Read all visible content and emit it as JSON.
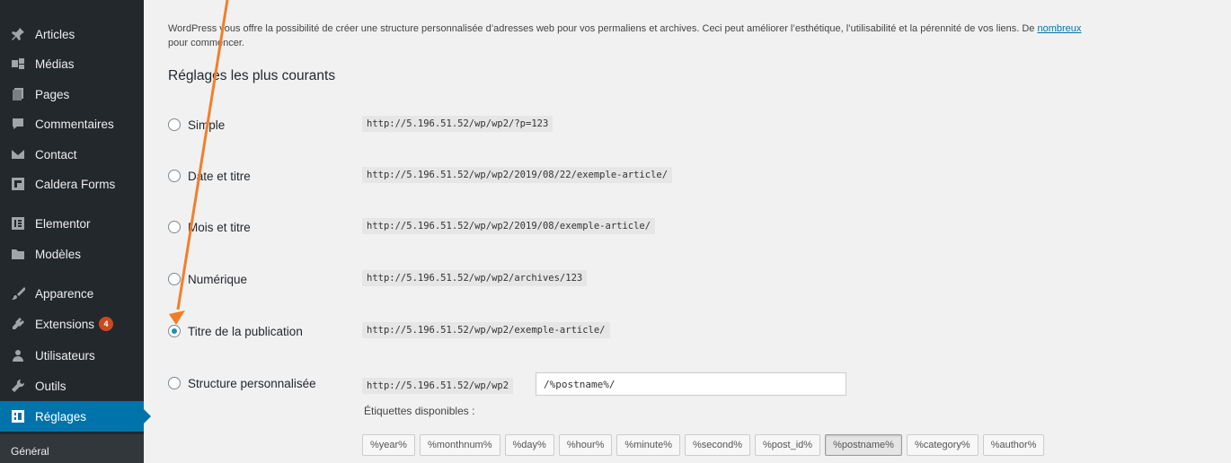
{
  "sidebar": {
    "items": [
      {
        "label": "Articles",
        "icon": "pin-icon"
      },
      {
        "label": "Médias",
        "icon": "media-icon"
      },
      {
        "label": "Pages",
        "icon": "pages-icon"
      },
      {
        "label": "Commentaires",
        "icon": "comment-icon"
      },
      {
        "label": "Contact",
        "icon": "mail-icon"
      },
      {
        "label": "Caldera Forms",
        "icon": "caldera-icon"
      },
      {
        "label": "Elementor",
        "icon": "elementor-icon"
      },
      {
        "label": "Modèles",
        "icon": "folder-icon"
      },
      {
        "label": "Apparence",
        "icon": "brush-icon"
      },
      {
        "label": "Extensions",
        "icon": "plugin-icon",
        "badge": "4"
      },
      {
        "label": "Utilisateurs",
        "icon": "users-icon"
      },
      {
        "label": "Outils",
        "icon": "wrench-icon"
      },
      {
        "label": "Réglages",
        "icon": "settings-icon",
        "active": true
      }
    ],
    "submenu": {
      "label": "Général"
    }
  },
  "intro": {
    "text": "WordPress vous offre la possibilité de créer une structure personnalisée d’adresses web pour vos permaliens et archives. Ceci peut améliorer l’esthétique, l’utilisabilité et la pérennité de vos liens. De ",
    "link": "nombreux",
    "line2": "pour commencer."
  },
  "section_title": "Réglages les plus courants",
  "options": [
    {
      "label": "Simple",
      "url": "http://5.196.51.52/wp/wp2/?p=123",
      "checked": false
    },
    {
      "label": "Date et titre",
      "url": "http://5.196.51.52/wp/wp2/2019/08/22/exemple-article/",
      "checked": false
    },
    {
      "label": "Mois et titre",
      "url": "http://5.196.51.52/wp/wp2/2019/08/exemple-article/",
      "checked": false
    },
    {
      "label": "Numérique",
      "url": "http://5.196.51.52/wp/wp2/archives/123",
      "checked": false
    },
    {
      "label": "Titre de la publication",
      "url": "http://5.196.51.52/wp/wp2/exemple-article/",
      "checked": true
    },
    {
      "label": "Structure personnalisée",
      "url": "http://5.196.51.52/wp/wp2",
      "checked": false
    }
  ],
  "custom_structure_value": "/%postname%/",
  "available_tags_label": "Étiquettes disponibles :",
  "tags": [
    "%year%",
    "%monthnum%",
    "%day%",
    "%hour%",
    "%minute%",
    "%second%",
    "%post_id%",
    "%postname%",
    "%category%",
    "%author%"
  ],
  "active_tag": "%postname%",
  "colors": {
    "sidebar": "#23282d",
    "active": "#0073aa",
    "badge": "#ca4a1f",
    "arrow": "#f07f2a"
  }
}
